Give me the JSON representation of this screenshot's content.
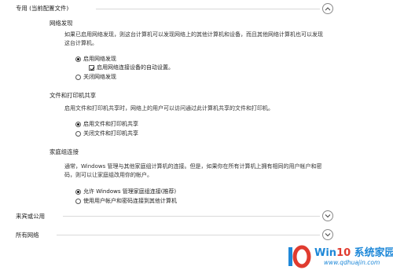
{
  "private": {
    "header": "专用 (当前配置文件)",
    "network_discovery": {
      "title": "网络发现",
      "description": "如果已启用网络发现，则这台计算机可以发现网络上的其他计算机和设备，而且其他网络计算机也可以发现这台计算机。",
      "opt_on": "启用网络发现",
      "opt_auto": "启用网络连接设备的自动设置。",
      "opt_off": "关闭网络发现"
    },
    "file_sharing": {
      "title": "文件和打印机共享",
      "description": "启用文件和打印机共享时，网络上的用户可以访问通过此计算机共享的文件和打印机。",
      "opt_on": "启用文件和打印机共享",
      "opt_off": "关闭文件和打印机共享"
    },
    "homegroup": {
      "title": "家庭组连接",
      "description": "通常，Windows 管理与其他家庭组计算机的连接。但是，如果你在所有计算机上拥有相同的用户帐户和密码，则可以让家庭组改用你的帐户。",
      "opt_allow": "允许 Windows 管理家庭组连接(推荐)",
      "opt_user": "使用用户帐户和密码连接到其他计算机"
    }
  },
  "guest": {
    "header": "来宾或公用"
  },
  "all": {
    "header": "所有网络"
  },
  "watermark": {
    "title_a": "Win",
    "title_b": "10",
    "title_c": " 系统家园",
    "url": "www.qdhuajin.com"
  },
  "state": {
    "network_discovery": "on",
    "auto_setup": true,
    "file_sharing": "on",
    "homegroup": "allow"
  }
}
